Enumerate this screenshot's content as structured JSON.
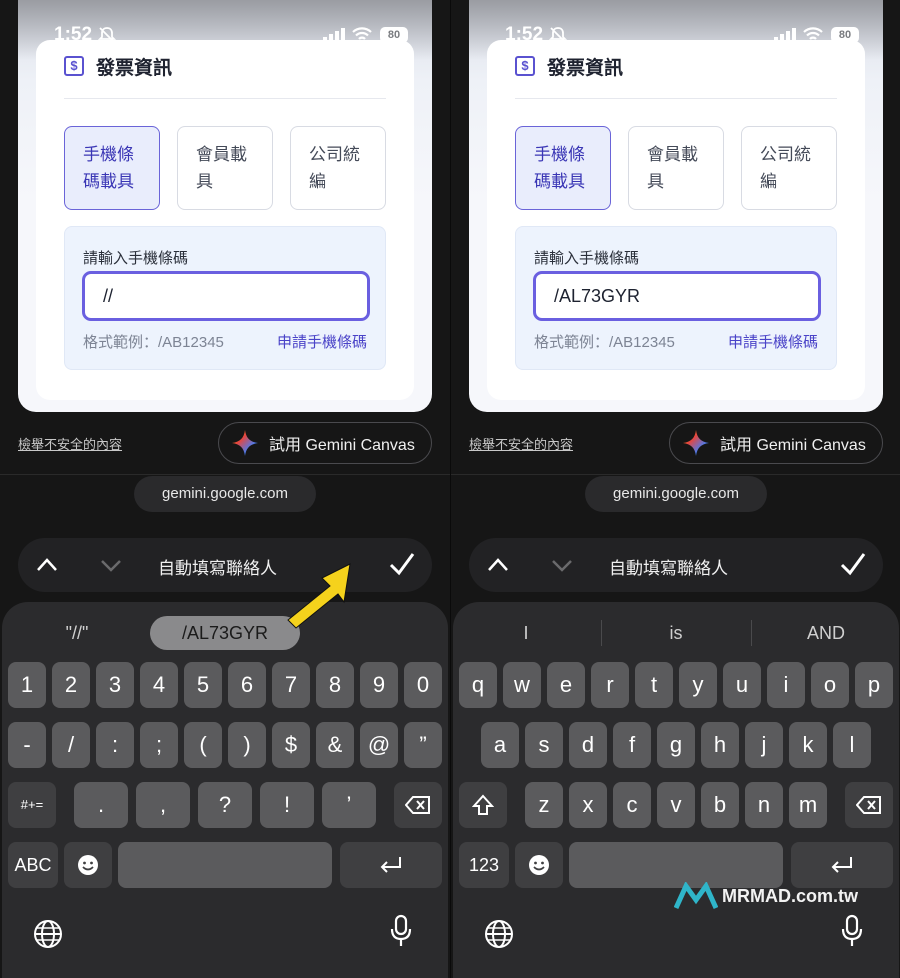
{
  "status_bar": {
    "time": "1:52",
    "battery": "80"
  },
  "invoice": {
    "title": "發票資訊",
    "icon": "dollar-icon",
    "options": [
      {
        "line1": "手機條",
        "line2": "碼載具",
        "active": true
      },
      {
        "line1": "會員載",
        "line2": "具",
        "active": false
      },
      {
        "line1": "公司統",
        "line2": "編",
        "active": false
      }
    ],
    "input_label": "請輸入手機條碼",
    "format_hint": "格式範例：/AB12345",
    "apply_link": "申請手機條碼"
  },
  "left": {
    "input_value": "//",
    "suggestions": [
      "\"//\"",
      "/AL73GYR"
    ]
  },
  "right": {
    "input_value": "/AL73GYR",
    "suggestions": [
      "I",
      "is",
      "AND"
    ]
  },
  "report_unsafe": "檢舉不安全的內容",
  "gemini_button": "試用 Gemini Canvas",
  "url": "gemini.google.com",
  "autofill": "自動填寫聯絡人",
  "keyboard_left": {
    "row1": [
      "1",
      "2",
      "3",
      "4",
      "5",
      "6",
      "7",
      "8",
      "9",
      "0"
    ],
    "row2": [
      "-",
      "/",
      ":",
      ";",
      "(",
      ")",
      "$",
      "&",
      "@",
      "”"
    ],
    "row3": [
      ".",
      ",",
      "?",
      "!",
      "’"
    ],
    "mode_key": "#+=",
    "abc_key": "ABC"
  },
  "keyboard_right": {
    "row1": [
      "q",
      "w",
      "e",
      "r",
      "t",
      "y",
      "u",
      "i",
      "o",
      "p"
    ],
    "row2": [
      "a",
      "s",
      "d",
      "f",
      "g",
      "h",
      "j",
      "k",
      "l"
    ],
    "row3": [
      "z",
      "x",
      "c",
      "v",
      "b",
      "n",
      "m"
    ],
    "num_key": "123"
  },
  "watermark": "MRMAD.com.tw",
  "colors": {
    "accent": "#5a52d0",
    "arrow": "#f5d21c",
    "keyboard": "#2b2b2d",
    "key": "#5b5b5d"
  }
}
